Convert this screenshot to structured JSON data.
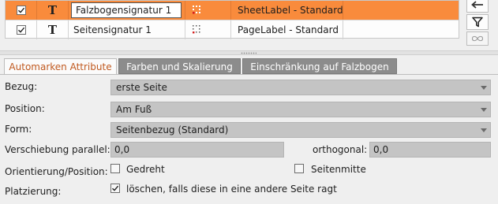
{
  "list": {
    "rows": [
      {
        "enabled": true,
        "type_icon": "T",
        "name": "Falzbogensignatur 1",
        "label": "SheetLabel - Standard",
        "selected": true
      },
      {
        "enabled": true,
        "type_icon": "T",
        "name": "Seitensignatur 1",
        "label": "PageLabel - Standard",
        "selected": false
      }
    ]
  },
  "toolbar": {
    "back_icon": "arrow-left-icon",
    "filter_icon": "funnel-icon",
    "link_icon": "infinity-icon"
  },
  "tabs": [
    {
      "label": "Automarken Attribute",
      "active": true
    },
    {
      "label": "Farben und Skalierung",
      "active": false
    },
    {
      "label": "Einschränkung auf Falzbogen",
      "active": false
    }
  ],
  "form": {
    "bezug": {
      "label": "Bezug:",
      "value": "erste Seite"
    },
    "position": {
      "label": "Position:",
      "value": "Am Fuß"
    },
    "form": {
      "label": "Form:",
      "value": "Seitenbezug (Standard)"
    },
    "verschiebung": {
      "label": "Verschiebung parallel:",
      "parallel_value": "0,0",
      "orthogonal_label": "orthogonal:",
      "orthogonal_value": "0,0"
    },
    "orientierung": {
      "label": "Orientierung/Position:",
      "gedreht_label": "Gedreht",
      "gedreht_checked": false,
      "seitenmitte_label": "Seitenmitte",
      "seitenmitte_checked": false
    },
    "platzierung": {
      "label": "Platzierung:",
      "option_label": "löschen, falls diese in eine andere Seite ragt",
      "option_checked": true
    }
  },
  "colors": {
    "selection": "#f98b3c",
    "active_tab_text": "#c0591f",
    "inactive_tab_bg": "#8c8c8c",
    "field_bg": "#c4c4c4"
  }
}
